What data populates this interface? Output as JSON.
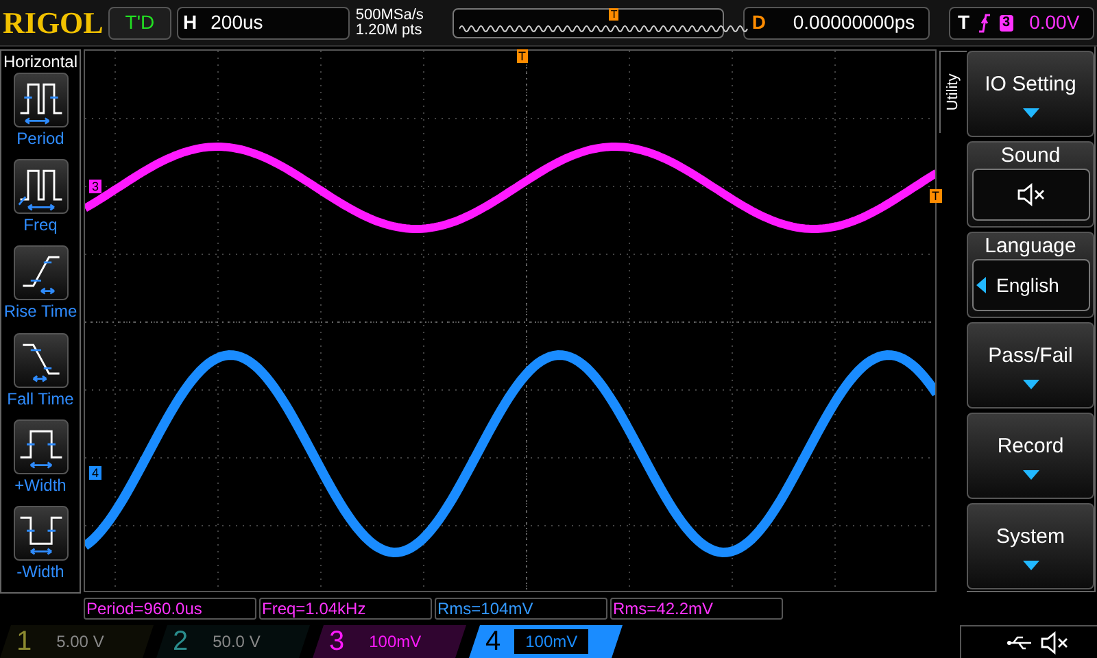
{
  "top_bar": {
    "logo": "RIGOL",
    "trigger_status": "T'D",
    "horizontal": {
      "label": "H",
      "value": "200us"
    },
    "sample_rate": "500MSa/s",
    "memory_depth": "1.20M pts",
    "delay": {
      "label": "D",
      "value": "0.00000000ps"
    },
    "trigger": {
      "label": "T",
      "source": "3",
      "level": "0.00V"
    }
  },
  "left_menu": {
    "title": "Horizontal",
    "items": [
      {
        "kind": "period",
        "label": "Period"
      },
      {
        "kind": "freq",
        "label": "Freq"
      },
      {
        "kind": "rise",
        "label": "Rise Time"
      },
      {
        "kind": "fall",
        "label": "Fall Time"
      },
      {
        "kind": "pwidth",
        "label": "+Width"
      },
      {
        "kind": "nwidth",
        "label": "-Width"
      }
    ]
  },
  "markers": {
    "trigger_overview": "T",
    "trigger_top": "T",
    "trigger_right": "T",
    "channel_3": "3",
    "channel_4": "4"
  },
  "right_menu": {
    "tab": "Utility",
    "items": [
      {
        "kind": "submenu",
        "label": "IO Setting"
      },
      {
        "kind": "mute",
        "label": "Sound",
        "muted": true
      },
      {
        "kind": "select",
        "label": "Language",
        "value": "English"
      },
      {
        "kind": "submenu",
        "label": "Pass/Fail"
      },
      {
        "kind": "submenu",
        "label": "Record"
      },
      {
        "kind": "submenu",
        "label": "System"
      }
    ]
  },
  "measurements": [
    {
      "text": "Period=960.0us",
      "color": "#ff33ff"
    },
    {
      "text": "Freq=1.04kHz",
      "color": "#ff33ff"
    },
    {
      "text": "Rms=104mV",
      "color": "#3399ff"
    },
    {
      "text": "Rms=42.2mV",
      "color": "#ff33ff"
    }
  ],
  "channels": [
    {
      "number": "1",
      "scale": "5.00 V",
      "on": false,
      "selected": false,
      "color": "#8c8a30"
    },
    {
      "number": "2",
      "scale": "50.0 V",
      "on": false,
      "selected": false,
      "color": "#2a8c8c"
    },
    {
      "number": "3",
      "scale": "100mV",
      "on": true,
      "selected": false,
      "color": "#ff1aff"
    },
    {
      "number": "4",
      "scale": "100mV",
      "on": true,
      "selected": true,
      "color": "#1a8cff"
    }
  ]
}
